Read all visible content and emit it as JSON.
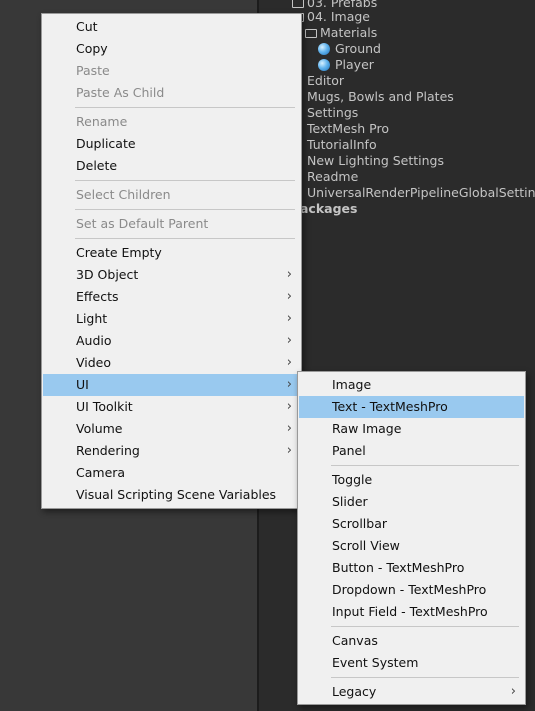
{
  "project_tree": [
    {
      "label": "03. Prefabs",
      "type": "folder"
    },
    {
      "label": "04. Image",
      "type": "folder"
    },
    {
      "label": "Materials",
      "type": "folder-open"
    },
    {
      "label": "Ground",
      "type": "material"
    },
    {
      "label": "Player",
      "type": "material"
    },
    {
      "label": "Editor",
      "type": "folder"
    },
    {
      "label": "Mugs, Bowls and Plates",
      "type": "folder"
    },
    {
      "label": "Settings",
      "type": "folder"
    },
    {
      "label": "TextMesh Pro",
      "type": "folder"
    },
    {
      "label": "TutorialInfo",
      "type": "folder"
    },
    {
      "label": "New Lighting Settings",
      "type": "asset"
    },
    {
      "label": "Readme",
      "type": "asset"
    },
    {
      "label": "UniversalRenderPipelineGlobalSettings",
      "type": "asset"
    },
    {
      "label": "ackages",
      "type": "root"
    }
  ],
  "context_menu": {
    "items": [
      {
        "label": "Cut",
        "enabled": true
      },
      {
        "label": "Copy",
        "enabled": true
      },
      {
        "label": "Paste",
        "enabled": false
      },
      {
        "label": "Paste As Child",
        "enabled": false
      },
      {
        "label": "Rename",
        "enabled": false
      },
      {
        "label": "Duplicate",
        "enabled": true
      },
      {
        "label": "Delete",
        "enabled": true
      },
      {
        "label": "Select Children",
        "enabled": false
      },
      {
        "label": "Set as Default Parent",
        "enabled": false
      },
      {
        "label": "Create Empty",
        "enabled": true
      },
      {
        "label": "3D Object",
        "enabled": true,
        "submenu": true
      },
      {
        "label": "Effects",
        "enabled": true,
        "submenu": true
      },
      {
        "label": "Light",
        "enabled": true,
        "submenu": true
      },
      {
        "label": "Audio",
        "enabled": true,
        "submenu": true
      },
      {
        "label": "Video",
        "enabled": true,
        "submenu": true
      },
      {
        "label": "UI",
        "enabled": true,
        "submenu": true,
        "highlighted": true
      },
      {
        "label": "UI Toolkit",
        "enabled": true,
        "submenu": true
      },
      {
        "label": "Volume",
        "enabled": true,
        "submenu": true
      },
      {
        "label": "Rendering",
        "enabled": true,
        "submenu": true
      },
      {
        "label": "Camera",
        "enabled": true
      },
      {
        "label": "Visual Scripting Scene Variables",
        "enabled": true
      }
    ]
  },
  "ui_submenu": {
    "items": [
      {
        "label": "Image"
      },
      {
        "label": "Text - TextMeshPro",
        "highlighted": true
      },
      {
        "label": "Raw Image"
      },
      {
        "label": "Panel"
      },
      {
        "label": "Toggle"
      },
      {
        "label": "Slider"
      },
      {
        "label": "Scrollbar"
      },
      {
        "label": "Scroll View"
      },
      {
        "label": "Button - TextMeshPro"
      },
      {
        "label": "Dropdown - TextMeshPro"
      },
      {
        "label": "Input Field - TextMeshPro"
      },
      {
        "label": "Canvas"
      },
      {
        "label": "Event System"
      },
      {
        "label": "Legacy",
        "submenu": true
      }
    ]
  },
  "icons": {
    "submenu_arrow": "chevron-right-icon",
    "material": "material-sphere-icon",
    "folder": "folder-icon"
  },
  "colors": {
    "background": "#383838",
    "panel": "#2b2b2b",
    "menu_bg": "#f0f0f0",
    "highlight": "#99c9ef",
    "disabled_text": "#8a8a8a"
  }
}
